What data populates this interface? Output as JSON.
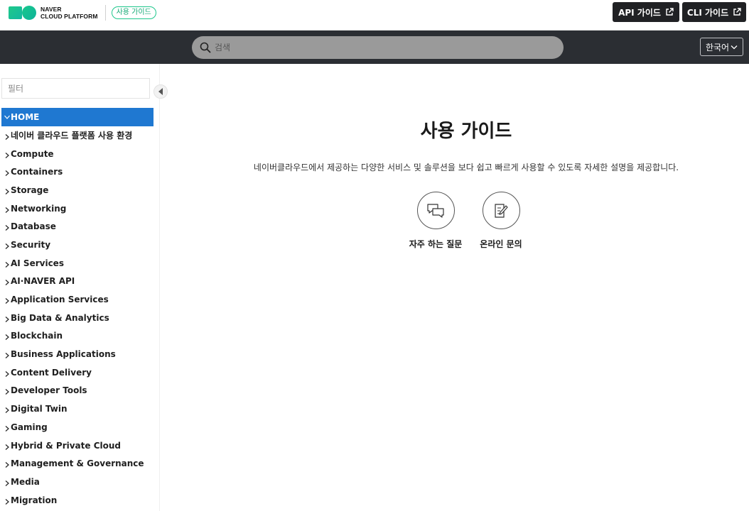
{
  "header": {
    "logo_line1": "NAVER",
    "logo_line2": "CLOUD PLATFORM",
    "guide_badge": "사용 가이드",
    "api_button": "API 가이드",
    "cli_button": "CLI 가이드"
  },
  "search": {
    "placeholder": "검색",
    "value": ""
  },
  "language": {
    "selected": "한국어"
  },
  "sidebar": {
    "filter_placeholder": "필터",
    "items": [
      {
        "label": "HOME",
        "active": true
      },
      {
        "label": "네이버 클라우드 플랫폼 사용 환경"
      },
      {
        "label": "Compute"
      },
      {
        "label": "Containers"
      },
      {
        "label": "Storage"
      },
      {
        "label": "Networking"
      },
      {
        "label": "Database"
      },
      {
        "label": "Security"
      },
      {
        "label": "AI Services"
      },
      {
        "label": "AI·NAVER API"
      },
      {
        "label": "Application Services"
      },
      {
        "label": "Big Data & Analytics"
      },
      {
        "label": "Blockchain"
      },
      {
        "label": "Business Applications"
      },
      {
        "label": "Content Delivery"
      },
      {
        "label": "Developer Tools"
      },
      {
        "label": "Digital Twin"
      },
      {
        "label": "Gaming"
      },
      {
        "label": "Hybrid & Private Cloud"
      },
      {
        "label": "Management & Governance"
      },
      {
        "label": "Media"
      },
      {
        "label": "Migration"
      }
    ]
  },
  "main": {
    "title": "사용 가이드",
    "description": "네이버클라우드에서 제공하는 다양한 서비스 및 솔루션을 보다 쉽고 빠르게 사용할 수 있도록 자세한 설명을 제공합니다.",
    "links": {
      "faq": "자주 하는 질문",
      "inquiry": "온라인 문의"
    }
  },
  "colors": {
    "header_dark": "#202124",
    "search_band": "#2b2e33",
    "active_nav": "#1f78d1",
    "brand_green": "#1ec78c"
  }
}
